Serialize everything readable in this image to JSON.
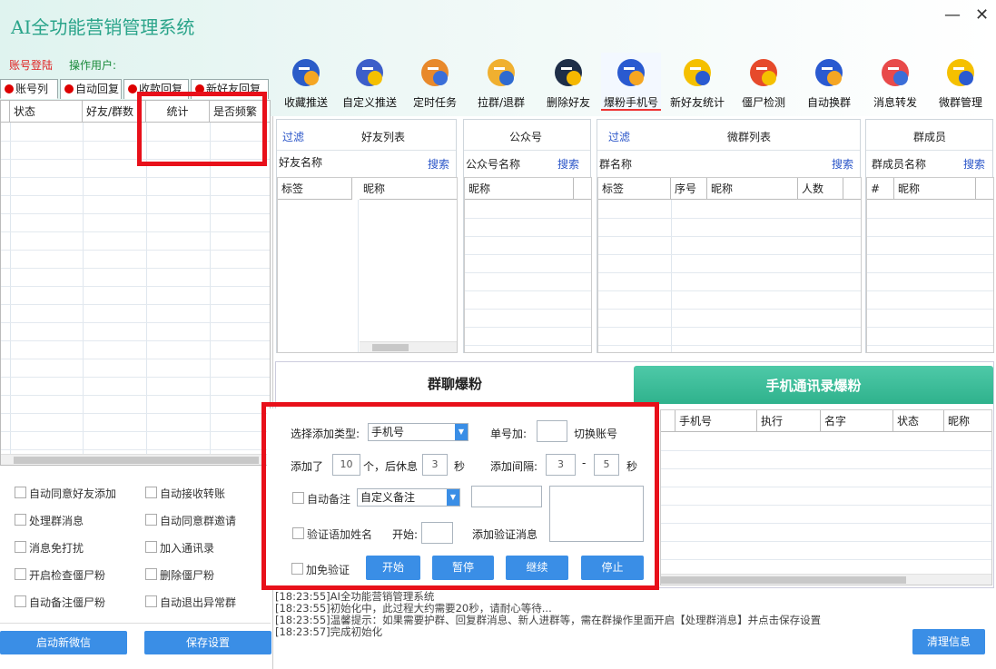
{
  "app": {
    "title": "AI全功能营销管理系统",
    "login": "账号登陆",
    "operator": "操作用户:",
    "minimize": "—",
    "close": "✕"
  },
  "toolbar": [
    {
      "label": "收藏推送",
      "icon": "favorites-push-icon"
    },
    {
      "label": "自定义推送",
      "icon": "custom-push-icon"
    },
    {
      "label": "定时任务",
      "icon": "timed-task-icon"
    },
    {
      "label": "拉群/退群",
      "icon": "group-join-icon"
    },
    {
      "label": "删除好友",
      "icon": "delete-friend-icon"
    },
    {
      "label": "爆粉手机号",
      "icon": "phone-search-icon"
    },
    {
      "label": "新好友统计",
      "icon": "new-friend-stats-icon"
    },
    {
      "label": "僵尸检测",
      "icon": "zombie-detect-icon"
    },
    {
      "label": "自动换群",
      "icon": "auto-switch-icon"
    },
    {
      "label": "消息转发",
      "icon": "message-forward-icon"
    },
    {
      "label": "微群管理",
      "icon": "group-manage-icon"
    }
  ],
  "left_tabs": [
    "账号列",
    "自动回复",
    "收款回复",
    "新好友回复"
  ],
  "account_table": {
    "headers": [
      "状态",
      "好友/群数",
      "统计",
      "是否频繁"
    ]
  },
  "left_options": [
    [
      "自动同意好友添加",
      "自动接收转账"
    ],
    [
      "处理群消息",
      "自动同意群邀请"
    ],
    [
      "消息免打扰",
      "加入通讯录"
    ],
    [
      "开启检查僵尸粉",
      "删除僵尸粉"
    ],
    [
      "自动备注僵尸粉",
      "自动退出异常群"
    ]
  ],
  "left_buttons": {
    "start": "启动新微信",
    "save": "保存设置"
  },
  "panels": {
    "friends": {
      "filter": "过滤",
      "title": "好友列表",
      "field": "好友名称",
      "search": "搜索",
      "cols": [
        "标签",
        "昵称"
      ]
    },
    "official": {
      "title": "公众号",
      "field": "公众号名称",
      "search": "搜索",
      "cols": [
        "昵称"
      ]
    },
    "groups": {
      "filter": "过滤",
      "title": "微群列表",
      "field": "群名称",
      "search": "搜索",
      "cols": [
        "标签",
        "序号",
        "昵称",
        "人数"
      ]
    },
    "members": {
      "title": "群成员",
      "field": "群成员名称",
      "search": "搜索",
      "cols": [
        "#",
        "昵称"
      ]
    }
  },
  "bottom_tabs": {
    "active": "群聊爆粉",
    "inactive": "手机通讯录爆粉"
  },
  "result_table": {
    "headers": [
      "手机号",
      "执行",
      "名字",
      "状态",
      "昵称"
    ]
  },
  "form": {
    "type_label": "选择添加类型:",
    "type_value": "手机号",
    "single_label": "单号加:",
    "switch_label": "切换账号",
    "added_label": "添加了",
    "added_value": "10",
    "rest_label": "个，后休息",
    "rest_value": "3",
    "sec": "秒",
    "interval_label": "添加间隔:",
    "interval_min": "3",
    "dash": "-",
    "interval_max": "5",
    "sec2": "秒",
    "auto_remark": "自动备注",
    "remark_value": "自定义备注",
    "verify_name": "验证语加姓名",
    "start_label": "开始:",
    "verify_msg": "添加验证消息",
    "no_verify": "加免验证",
    "btn_start": "开始",
    "btn_pause": "暂停",
    "btn_continue": "继续",
    "btn_stop": "停止"
  },
  "log": [
    "[18:23:55]AI全功能营销管理系统",
    "[18:23:55]初始化中，此过程大约需要20秒，请耐心等待...",
    "[18:23:55]温馨提示：如果需要护群、回复群消息、新人进群等，需在群操作里面开启【处理群消息】并点击保存设置",
    "[18:23:57]完成初始化"
  ],
  "clear_button": "清理信息",
  "colors": {
    "accent": "#3a8ee6",
    "highlight": "#e8101a",
    "title": "#2aa48a"
  }
}
